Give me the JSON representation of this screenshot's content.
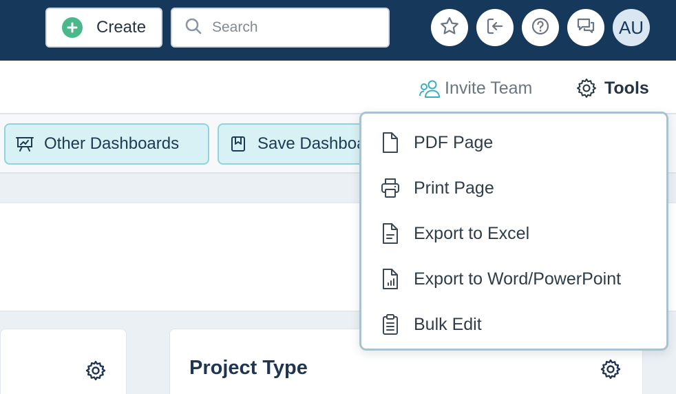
{
  "topbar": {
    "create_label": "Create",
    "search_placeholder": "Search",
    "icons": [
      "star-icon",
      "sign-out-icon",
      "help-icon",
      "chat-icon"
    ],
    "avatar_initials": "AU"
  },
  "subheader": {
    "invite_label": "Invite Team",
    "tools_label": "Tools"
  },
  "toolbar": {
    "other_dashboards_label": "Other Dashboards",
    "save_dashboard_label": "Save Dashboard"
  },
  "cards": {
    "project_type_title": "Project Type"
  },
  "tools_menu": {
    "items": [
      {
        "label": "PDF Page",
        "icon": "file-icon"
      },
      {
        "label": "Print Page",
        "icon": "printer-icon"
      },
      {
        "label": "Export to Excel",
        "icon": "file-text-icon"
      },
      {
        "label": "Export to Word/PowerPoint",
        "icon": "file-chart-icon"
      },
      {
        "label": "Bulk Edit",
        "icon": "clipboard-list-icon"
      }
    ]
  },
  "colors": {
    "topbar_bg": "#16395b",
    "accent_green": "#4ab88a",
    "pill_bg": "#d7f1f4",
    "pill_border": "#8fd3dc",
    "invite_icon": "#3aaec0"
  }
}
